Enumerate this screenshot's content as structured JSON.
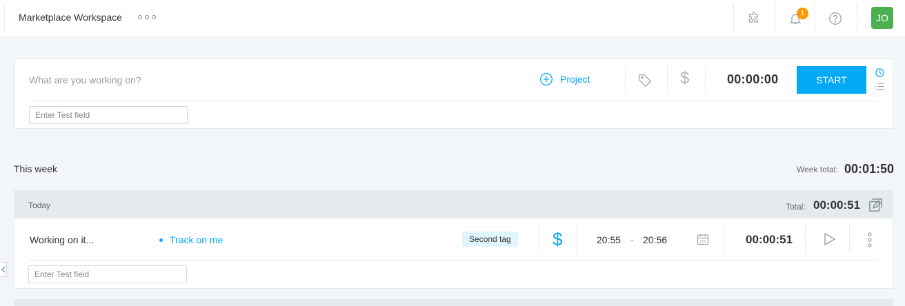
{
  "topbar": {
    "workspace_name": "Marketplace Workspace",
    "notification_count": "1",
    "avatar_initials": "JO",
    "avatar_color": "#4caf50",
    "icons": [
      "more-horizontal-icon",
      "puzzle-icon",
      "bell-icon",
      "help-icon"
    ]
  },
  "tracker": {
    "description_placeholder": "What are you working on?",
    "project_label": "Project",
    "timer": "00:00:00",
    "start_label": "START",
    "custom_field_placeholder": "Enter Test field"
  },
  "week": {
    "title": "This week",
    "total_label": "Week total:",
    "total_value": "00:01:50"
  },
  "day": {
    "label": "Today",
    "total_label": "Total:",
    "total_value": "00:00:51",
    "entries": [
      {
        "description": "Working on it...",
        "project": "Track on me",
        "tag": "Second tag",
        "billable": true,
        "start": "20:55",
        "dash": "-",
        "end": "20:56",
        "duration": "00:00:51",
        "custom_field_placeholder": "Enter Test field"
      }
    ]
  },
  "colors": {
    "accent": "#03a9f4",
    "badge": "#ff9800",
    "header_bg": "#e4eaee",
    "page_bg": "#f2f6f8"
  }
}
